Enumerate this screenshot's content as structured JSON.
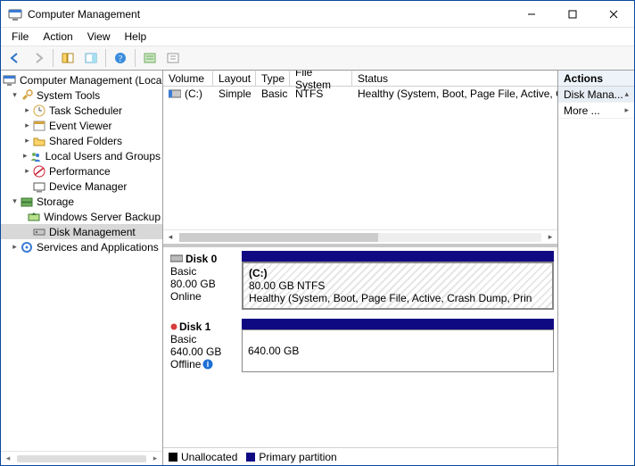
{
  "window": {
    "title": "Computer Management"
  },
  "menubar": [
    "File",
    "Action",
    "View",
    "Help"
  ],
  "toolbar": {
    "back": "back",
    "forward": "forward",
    "up": "up",
    "show_hide": "show-hide",
    "help": "help",
    "props": "properties",
    "refresh": "refresh"
  },
  "tree": {
    "root": "Computer Management (Local",
    "system_tools": "System Tools",
    "task_scheduler": "Task Scheduler",
    "event_viewer": "Event Viewer",
    "shared_folders": "Shared Folders",
    "local_users": "Local Users and Groups",
    "performance": "Performance",
    "device_manager": "Device Manager",
    "storage": "Storage",
    "ws_backup": "Windows Server Backup",
    "disk_mgmt": "Disk Management",
    "services": "Services and Applications"
  },
  "volumes": {
    "columns": [
      "Volume",
      "Layout",
      "Type",
      "File System",
      "Status"
    ],
    "rows": [
      {
        "name": "(C:)",
        "layout": "Simple",
        "type": "Basic",
        "fs": "NTFS",
        "status": "Healthy (System, Boot, Page File, Active, Crash Dum"
      }
    ]
  },
  "disks": [
    {
      "name": "Disk 0",
      "kind": "Basic",
      "size": "80.00 GB",
      "status": "Online",
      "offline": false,
      "partition": {
        "label": "(C:)",
        "detail": "80.00 GB NTFS",
        "health": "Healthy (System, Boot, Page File, Active, Crash Dump, Prin",
        "hatched": true
      }
    },
    {
      "name": "Disk 1",
      "kind": "Basic",
      "size": "640.00 GB",
      "status": "Offline",
      "offline": true,
      "partition": {
        "label": "",
        "detail": "640.00 GB",
        "health": "",
        "hatched": false
      }
    }
  ],
  "legend": {
    "unallocated": "Unallocated",
    "primary": "Primary partition"
  },
  "actions": {
    "header": "Actions",
    "item1": "Disk Mana...",
    "item2": "More ..."
  }
}
